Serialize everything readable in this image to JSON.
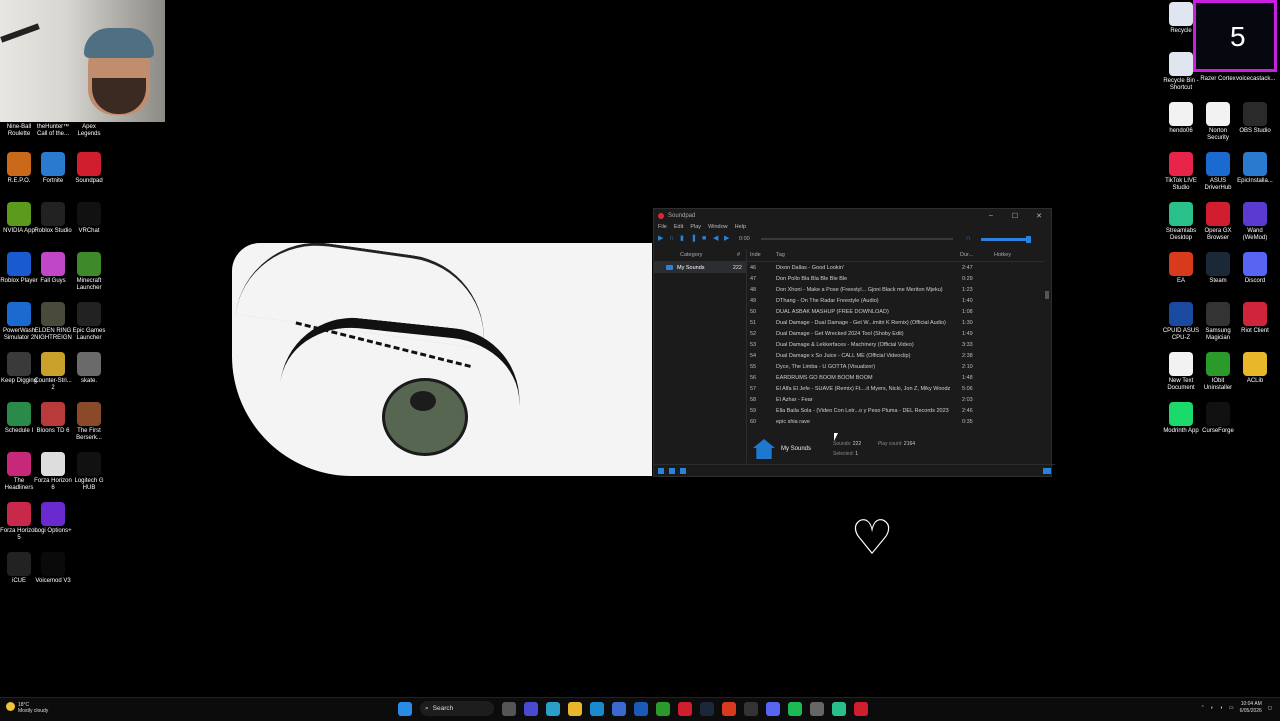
{
  "desktop": {
    "left_icons": [
      {
        "label": "Nine-Ball Roulette",
        "color": "#2c6f3a"
      },
      {
        "label": "theHunter™ Call of the...",
        "color": "#5a4a2a"
      },
      {
        "label": "Apex Legends",
        "color": "#b83a2a"
      },
      {
        "label": "R.E.P.O.",
        "color": "#c86a1a"
      },
      {
        "label": "Fortnite",
        "color": "#2a7ad0"
      },
      {
        "label": "Soundpad",
        "color": "#d01e2e"
      },
      {
        "label": "NVIDIA App",
        "color": "#5b9a1a"
      },
      {
        "label": "Roblox Studio",
        "color": "#222222"
      },
      {
        "label": "VRChat",
        "color": "#111111"
      },
      {
        "label": "Roblox Player",
        "color": "#1a5ad0"
      },
      {
        "label": "Fall Guys",
        "color": "#c048c8"
      },
      {
        "label": "Minecraft Launcher",
        "color": "#3e8a2a"
      },
      {
        "label": "PowerWash Simulator 2",
        "color": "#1a6ad0"
      },
      {
        "label": "ELDEN RING NIGHTREIGN",
        "color": "#4a4a3a"
      },
      {
        "label": "Epic Games Launcher",
        "color": "#222222"
      },
      {
        "label": "Keep Digging",
        "color": "#3a3a3a"
      },
      {
        "label": "Counter-Stri... 2",
        "color": "#c8a02a"
      },
      {
        "label": "skate.",
        "color": "#6a6a6a"
      },
      {
        "label": "Schedule I",
        "color": "#2a8a4a"
      },
      {
        "label": "Bloons TD 6",
        "color": "#b83a3a"
      },
      {
        "label": "The First Berserk...",
        "color": "#8a4a2a"
      },
      {
        "label": "The Headliners",
        "color": "#c8287a"
      },
      {
        "label": "Forza Horizon 6",
        "color": "#dddddd"
      },
      {
        "label": "Logitech G HUB",
        "color": "#111111"
      },
      {
        "label": "Forza Horizon 5",
        "color": "#c8284a"
      },
      {
        "label": "Logi Options+",
        "color": "#6a2ad0"
      },
      {
        "label": "iCUE",
        "color": "#222222"
      },
      {
        "label": "Voicemod V3",
        "color": "#0a0a0a"
      }
    ],
    "right_icons": [
      {
        "label": "Recycle",
        "color": "#dfe6ef"
      },
      {
        "label": "Recycle Bin - Shortcut",
        "color": "#dfe6ef"
      },
      {
        "label": "Razer Cortex",
        "color": "#1e1e1e"
      },
      {
        "label": "voicecastack...",
        "color": "#1e1e1e"
      },
      {
        "label": "hendo06",
        "color": "#f2f2f2"
      },
      {
        "label": "Norton Security",
        "color": "#f2f2f2"
      },
      {
        "label": "OBS Studio",
        "color": "#2a2a2a"
      },
      {
        "label": "TikTok LIVE Studio",
        "color": "#e8244a"
      },
      {
        "label": "ASUS DriverHub",
        "color": "#1a6ad0"
      },
      {
        "label": "EpicInstalla...",
        "color": "#2a7ad0"
      },
      {
        "label": "Streamlabs Desktop",
        "color": "#2ac08a"
      },
      {
        "label": "Opera GX Browser",
        "color": "#d01e2e"
      },
      {
        "label": "Wand (WeMod)",
        "color": "#5a3ad0"
      },
      {
        "label": "EA",
        "color": "#d83a1e"
      },
      {
        "label": "Steam",
        "color": "#1b2838"
      },
      {
        "label": "Discord",
        "color": "#5865f2"
      },
      {
        "label": "CPUID ASUS CPU-Z",
        "color": "#1a4aa0"
      },
      {
        "label": "Samsung Magician",
        "color": "#333333"
      },
      {
        "label": "Riot Client",
        "color": "#d0243a"
      },
      {
        "label": "New Text Document",
        "color": "#f2f2f2"
      },
      {
        "label": "IObit Uninstaller",
        "color": "#2a9a2a"
      },
      {
        "label": "ACLib",
        "color": "#e8b82a"
      },
      {
        "label": "Modrinth App",
        "color": "#1bd96a"
      },
      {
        "label": "CurseForge",
        "color": "#111111"
      }
    ],
    "stream_counter": "5"
  },
  "soundpad": {
    "title": "Soundpad",
    "menu": [
      "File",
      "Edit",
      "Play",
      "Window",
      "Help"
    ],
    "time": "0:00",
    "seek_fraction": 0.0,
    "volume_fraction": 1.0,
    "window_buttons": [
      "–",
      "☐",
      "✕"
    ],
    "categories_header": {
      "category": "Category",
      "count": "#"
    },
    "categories": [
      {
        "name": "My Sounds",
        "count": "222"
      }
    ],
    "columns": {
      "index": "Inde",
      "tag": "Tag",
      "duration": "Dur...",
      "hotkey": "Hotkey"
    },
    "rows": [
      {
        "index": "46",
        "tag": "Dixon Dallas - Good Lookin'",
        "dur": "2:47"
      },
      {
        "index": "47",
        "tag": "Don Pollo Bla Bla Ble Ble Ble",
        "dur": "0:29"
      },
      {
        "index": "48",
        "tag": "Don Xhoni - Make a Pose (Freestyl... Gjoni Black me Meriton Mjeku)",
        "dur": "1:23"
      },
      {
        "index": "49",
        "tag": "DThang - On The Radar Freestyle (Audio)",
        "dur": "1:40"
      },
      {
        "index": "50",
        "tag": "DUAL ASBAK MASHUP (FREE DOWNLOAD)",
        "dur": "1:08"
      },
      {
        "index": "51",
        "tag": "Dual Damage - Dual Damage - Get W...imitri K Remix) (Official Audio)",
        "dur": "1:30"
      },
      {
        "index": "52",
        "tag": "Dual Damage - Get Wrecked 2024 Tool (Shoby Edit)",
        "dur": "1:49"
      },
      {
        "index": "53",
        "tag": "Dual Damage & Lekkerfaces - Machinery (Official Video)",
        "dur": "3:33"
      },
      {
        "index": "54",
        "tag": "Dual Damage x So Juice - CALL ME (Official Videoclip)",
        "dur": "2:38"
      },
      {
        "index": "55",
        "tag": "Dyce, The Limba - U GOTTA (Visualizer)",
        "dur": "2:10"
      },
      {
        "index": "56",
        "tag": "EARDRUMS GO BOOM BOOM BOOM",
        "dur": "1:48"
      },
      {
        "index": "57",
        "tag": "El Alfa El Jefe - SUAVE (Remix) Ft....it Myers, Nicki, Jon Z, Miky Woodz",
        "dur": "5:06"
      },
      {
        "index": "58",
        "tag": "El Azhar - Fear",
        "dur": "2:03"
      },
      {
        "index": "59",
        "tag": "Ella Baila Sola - (Video Con Letr...o y Peso Pluma - DEL Records 2023",
        "dur": "2:46"
      },
      {
        "index": "60",
        "tag": "epic shia rave",
        "dur": "0:35"
      }
    ],
    "footer": {
      "category_name": "My Sounds",
      "sounds_label": "Sounds:",
      "sounds_value": "222",
      "selected_label": "Selected:",
      "selected_value": "1",
      "playcount_label": "Play count:",
      "playcount_value": "2164"
    },
    "accent_color": "#2a82da"
  },
  "taskbar": {
    "weather_temp": "18°C",
    "weather_desc": "Mostly cloudy",
    "search_label": "Search",
    "time": "10:04 AM",
    "date": "6/05/2026"
  }
}
